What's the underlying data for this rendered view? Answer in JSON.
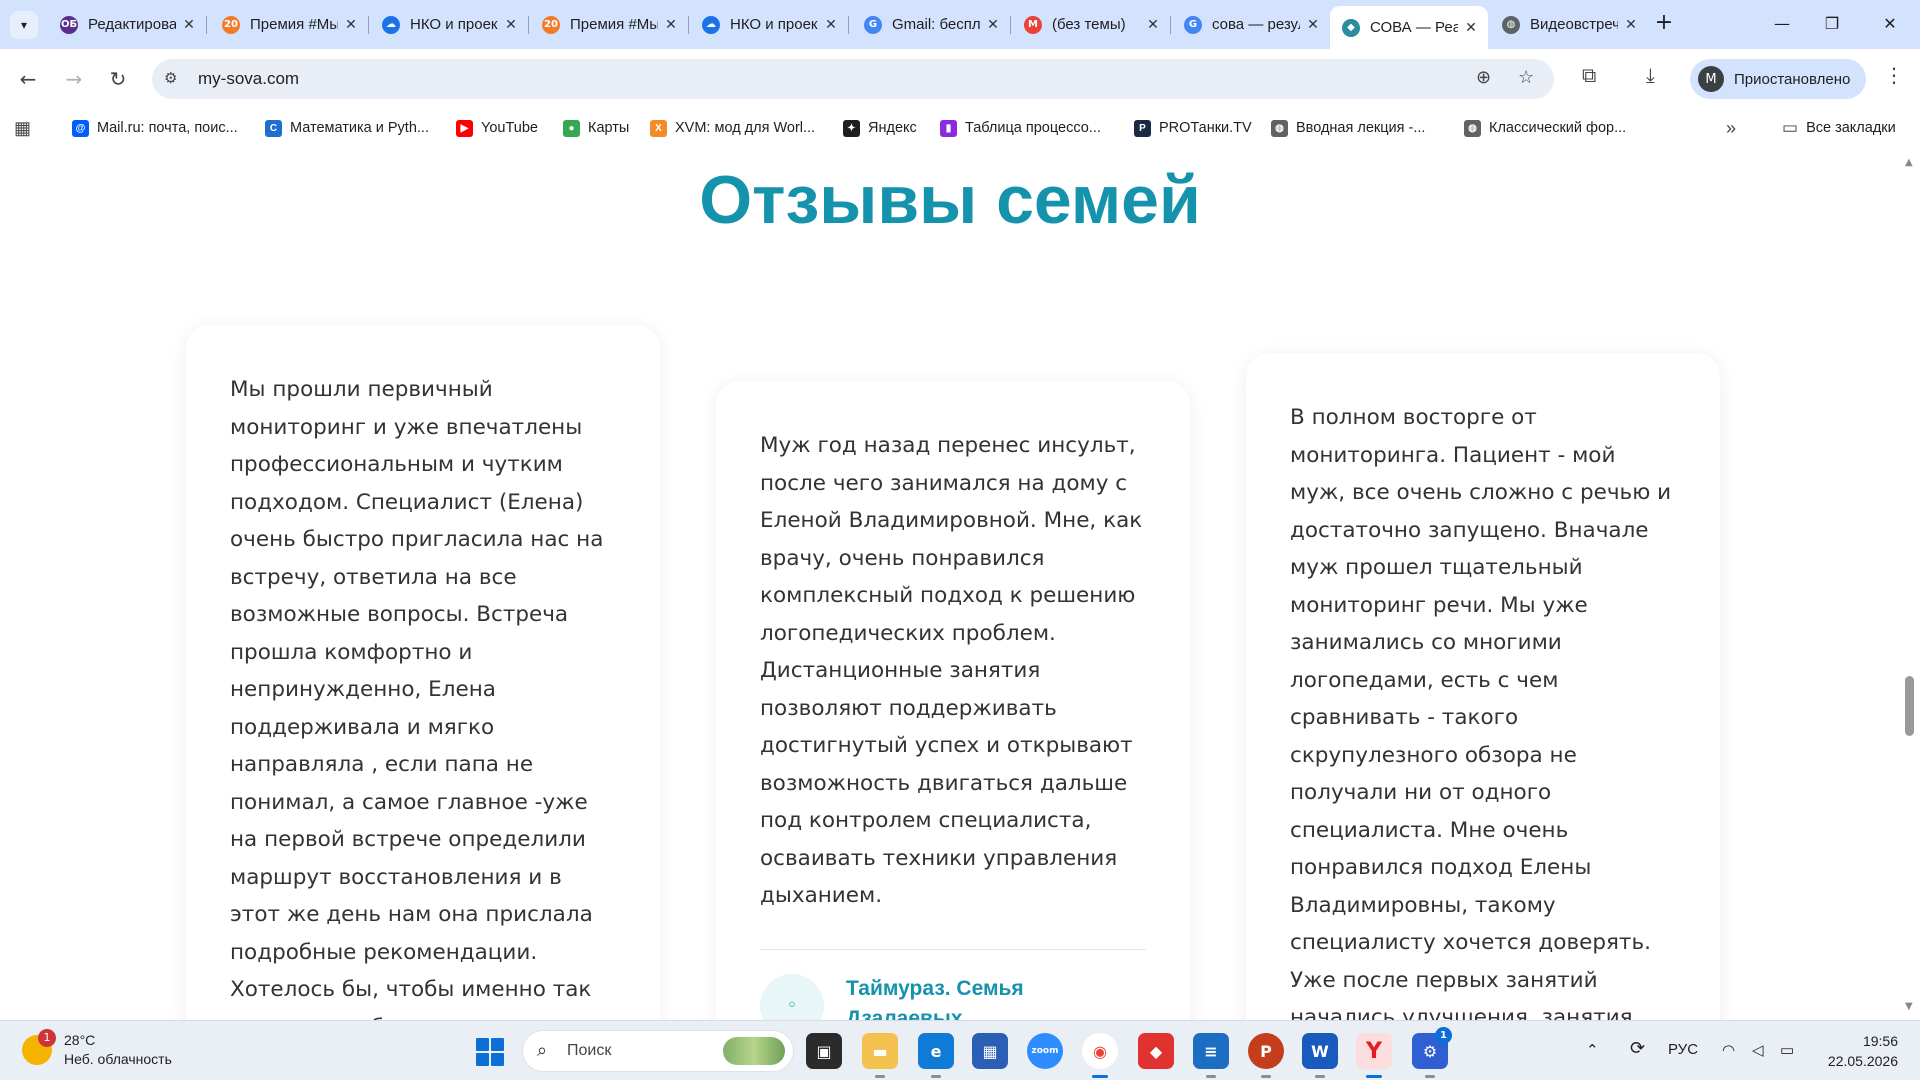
{
  "browser": {
    "tabs": [
      {
        "title": "Редактирование",
        "favicon": "owl-icon",
        "color": "#5b2d8e",
        "glyph": "ОБ"
      },
      {
        "title": "Премия #МыВместе",
        "favicon": "prize-icon",
        "color": "#f27b2a",
        "glyph": "20"
      },
      {
        "title": "НКО и проекты",
        "favicon": "cloud-icon",
        "color": "#1a73e8",
        "glyph": "☁"
      },
      {
        "title": "Премия #МыВместе",
        "favicon": "prize-icon",
        "color": "#f27b2a",
        "glyph": "20"
      },
      {
        "title": "НКО и проекты",
        "favicon": "cloud-icon",
        "color": "#1a73e8",
        "glyph": "☁"
      },
      {
        "title": "Gmail: бесплатная",
        "favicon": "google-icon",
        "color": "#4285f4",
        "glyph": "G"
      },
      {
        "title": "(без темы)",
        "favicon": "gmail-icon",
        "color": "#ea4335",
        "glyph": "M"
      },
      {
        "title": "сова — результаты",
        "favicon": "google-icon",
        "color": "#4285f4",
        "glyph": "G"
      },
      {
        "title": "СОВА — Реабилитация",
        "favicon": "sova-icon",
        "color": "#2a8c9c",
        "glyph": "◆",
        "active": true
      },
      {
        "title": "Видеовстреча",
        "favicon": "globe-icon",
        "color": "#5f6368",
        "glyph": "◍"
      }
    ],
    "url": "my-sova.com",
    "profile_initial": "М",
    "profile_label": "Приостановлено",
    "bookmarks": [
      {
        "label": "Mail.ru: почта, поис...",
        "icon": "mailru-icon",
        "color": "#005ff9",
        "glyph": "@"
      },
      {
        "label": "Математика и Pyth...",
        "icon": "stepik-icon",
        "color": "#1f6fd1",
        "glyph": "C"
      },
      {
        "label": "YouTube",
        "icon": "youtube-icon",
        "color": "#ff0000",
        "glyph": "▶"
      },
      {
        "label": "Карты",
        "icon": "maps-pin-icon",
        "color": "#34a853",
        "glyph": "●"
      },
      {
        "label": "XVM: мод для Worl...",
        "icon": "xvm-icon",
        "color": "#f28c28",
        "glyph": "X"
      },
      {
        "label": "Яндекс",
        "icon": "yandex-icon",
        "color": "#1f1f1f",
        "glyph": "✦"
      },
      {
        "label": "Таблица процессо...",
        "icon": "chart-bars-icon",
        "color": "#8a2be2",
        "glyph": "▮"
      },
      {
        "label": "PROТанки.TV",
        "icon": "protanki-icon",
        "color": "#1a2a44",
        "glyph": "P"
      },
      {
        "label": "Вводная лекция -...",
        "icon": "globe-icon",
        "color": "#5f6368",
        "glyph": "◍"
      },
      {
        "label": "Классический фор...",
        "icon": "globe-icon",
        "color": "#5f6368",
        "glyph": "◍"
      }
    ],
    "all_bookmarks_label": "Все закладки"
  },
  "page": {
    "section_title": "Отзывы семей",
    "reviews": [
      {
        "text": "Мы прошли первичный мониторинг и уже впечатлены профессиональным и чутким подходом. Специалист (Елена) очень быстро пригласила нас на встречу, ответила на все возможные вопросы. Встреча прошла комфортно и непринужденно, Елена поддерживала и мягко направляла , если папа не понимал, а самое главное -уже на первой встрече определили маршрут восстановления и в этот же день нам она прислала подробные рекомендации. Хотелось бы, чтобы именно так грамотно работали все специалисты в сфере",
        "author": ""
      },
      {
        "text": "Муж год назад перенес инсульт, после чего занимался на дому с Еленой Владимировной. Мне, как врачу, очень понравился комплексный подход к решению логопедических проблем. Дистанционные занятия позволяют поддерживать достигнутый успех и открывают возможность двигаться дальше под контролем специалиста, осваивать техники управления дыханием.",
        "author": "Таймураз. Семья Дзалаевых"
      },
      {
        "text": "В полном восторге от мониторинга. Пациент - мой муж, все очень сложно с речью и достаточно запущено. Вначале муж прошел тщательный мониторинг речи. Мы уже занимались со многими логопедами, есть с чем сравнивать - такого скрупулезного обзора не получали ни от одного специалиста. Мне очень понравился подход Елены Владимировны, такому специалисту хочется доверять. Уже после первых занятий начались улучшения, занятия мужу очень нравятся. Очень",
        "author": ""
      }
    ]
  },
  "taskbar": {
    "weather_temp": "28°C",
    "weather_desc": "Неб. облачность",
    "weather_badge": "1",
    "search_placeholder": "Поиск",
    "language": "РУС",
    "time": "19:56",
    "date": "22.05.2026",
    "notification_badge": "1"
  },
  "colors": {
    "accent": "#1592ac",
    "tabstrip": "#d3e3fd"
  }
}
